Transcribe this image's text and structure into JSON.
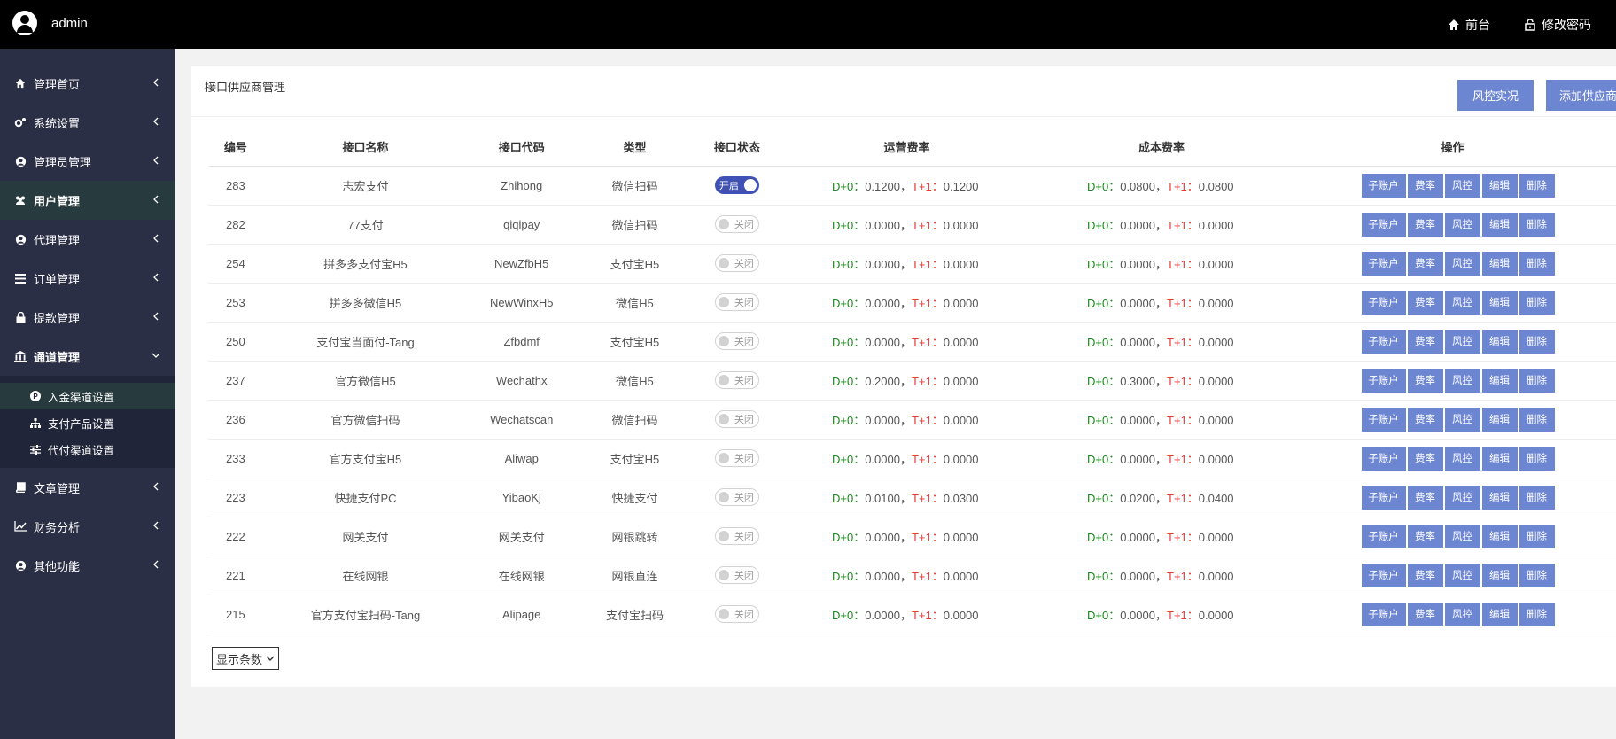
{
  "header": {
    "username": "admin",
    "front_link": "前台",
    "change_password": "修改密码"
  },
  "sidebar": {
    "items": [
      {
        "label": "管理首页"
      },
      {
        "label": "系统设置"
      },
      {
        "label": "管理员管理"
      },
      {
        "label": "用户管理"
      },
      {
        "label": "代理管理"
      },
      {
        "label": "订单管理"
      },
      {
        "label": "提款管理"
      },
      {
        "label": "通道管理"
      },
      {
        "label": "文章管理"
      },
      {
        "label": "财务分析"
      },
      {
        "label": "其他功能"
      }
    ],
    "submenu": [
      {
        "label": "入金渠道设置"
      },
      {
        "label": "支付产品设置"
      },
      {
        "label": "代付渠道设置"
      }
    ]
  },
  "main": {
    "title": "接口供应商管理",
    "risk_button": "风控实况",
    "add_button": "添加供应商",
    "columns": [
      "编号",
      "接口名称",
      "接口代码",
      "类型",
      "接口状态",
      "运营费率",
      "成本费率",
      "操作"
    ],
    "status_on": "开启",
    "status_off": "关闭",
    "d_label": "D+0：",
    "t_label": "T+1：",
    "sep": "，",
    "ops": [
      "子账户",
      "费率",
      "风控",
      "编辑",
      "删除"
    ],
    "rows": [
      {
        "id": "283",
        "name": "志宏支付",
        "code": "Zhihong",
        "type": "微信扫码",
        "on": true,
        "fee_d": "0.1200",
        "fee_t": "0.1200",
        "cost_d": "0.0800",
        "cost_t": "0.0800"
      },
      {
        "id": "282",
        "name": "77支付",
        "code": "qiqipay",
        "type": "微信扫码",
        "on": false,
        "fee_d": "0.0000",
        "fee_t": "0.0000",
        "cost_d": "0.0000",
        "cost_t": "0.0000"
      },
      {
        "id": "254",
        "name": "拼多多支付宝H5",
        "code": "NewZfbH5",
        "type": "支付宝H5",
        "on": false,
        "fee_d": "0.0000",
        "fee_t": "0.0000",
        "cost_d": "0.0000",
        "cost_t": "0.0000"
      },
      {
        "id": "253",
        "name": "拼多多微信H5",
        "code": "NewWinxH5",
        "type": "微信H5",
        "on": false,
        "fee_d": "0.0000",
        "fee_t": "0.0000",
        "cost_d": "0.0000",
        "cost_t": "0.0000"
      },
      {
        "id": "250",
        "name": "支付宝当面付-Tang",
        "code": "Zfbdmf",
        "type": "支付宝H5",
        "on": false,
        "fee_d": "0.0000",
        "fee_t": "0.0000",
        "cost_d": "0.0000",
        "cost_t": "0.0000"
      },
      {
        "id": "237",
        "name": "官方微信H5",
        "code": "Wechathx",
        "type": "微信H5",
        "on": false,
        "fee_d": "0.2000",
        "fee_t": "0.0000",
        "cost_d": "0.3000",
        "cost_t": "0.0000"
      },
      {
        "id": "236",
        "name": "官方微信扫码",
        "code": "Wechatscan",
        "type": "微信扫码",
        "on": false,
        "fee_d": "0.0000",
        "fee_t": "0.0000",
        "cost_d": "0.0000",
        "cost_t": "0.0000"
      },
      {
        "id": "233",
        "name": "官方支付宝H5",
        "code": "Aliwap",
        "type": "支付宝H5",
        "on": false,
        "fee_d": "0.0000",
        "fee_t": "0.0000",
        "cost_d": "0.0000",
        "cost_t": "0.0000"
      },
      {
        "id": "223",
        "name": "快捷支付PC",
        "code": "YibaoKj",
        "type": "快捷支付",
        "on": false,
        "fee_d": "0.0100",
        "fee_t": "0.0300",
        "cost_d": "0.0200",
        "cost_t": "0.0400"
      },
      {
        "id": "222",
        "name": "网关支付",
        "code": "网关支付",
        "type": "网银跳转",
        "on": false,
        "fee_d": "0.0000",
        "fee_t": "0.0000",
        "cost_d": "0.0000",
        "cost_t": "0.0000"
      },
      {
        "id": "221",
        "name": "在线网银",
        "code": "在线网银",
        "type": "网银直连",
        "on": false,
        "fee_d": "0.0000",
        "fee_t": "0.0000",
        "cost_d": "0.0000",
        "cost_t": "0.0000"
      },
      {
        "id": "215",
        "name": "官方支付宝扫码-Tang",
        "code": "Alipage",
        "type": "支付宝扫码",
        "on": false,
        "fee_d": "0.0000",
        "fee_t": "0.0000",
        "cost_d": "0.0000",
        "cost_t": "0.0000"
      }
    ],
    "pager_label": "显示条数"
  },
  "colors": {
    "accent": "#6d86d2",
    "switch_on": "#3f51b5",
    "green": "#1a8a1a",
    "red": "#e53935",
    "sidebar": "#2a2f45"
  }
}
